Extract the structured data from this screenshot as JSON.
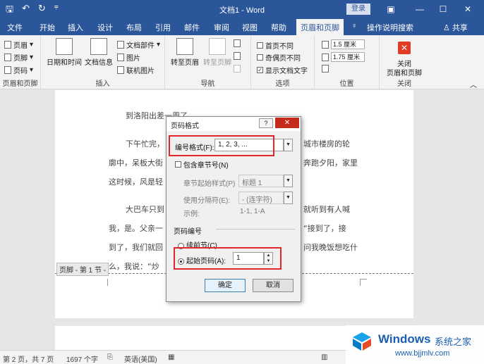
{
  "titlebar": {
    "title": "文档1 - Word",
    "login": "登录",
    "qat_save": "🖫",
    "qat_undo": "↶",
    "qat_redo": "↻",
    "qat_more": "⩦"
  },
  "tabs": [
    "文件",
    "开始",
    "插入",
    "设计",
    "布局",
    "引用",
    "邮件",
    "审阅",
    "视图",
    "帮助",
    "页眉和页脚",
    "操作说明搜索",
    "共享"
  ],
  "ribbon": {
    "hf_group": {
      "header": "页眉",
      "footer": "页脚",
      "page_number": "页码",
      "label": "页眉和页脚"
    },
    "insert_group": {
      "datetime": "日期和时间",
      "docinfo": "文档信息",
      "quickparts": "文档部件",
      "picture": "图片",
      "online_picture": "联机图片",
      "label": "插入"
    },
    "nav_group": {
      "goto_header": "转至页眉",
      "goto_footer": "转至页脚",
      "label": "导航"
    },
    "options_group": {
      "diff_first": "首页不同",
      "diff_odd_even": "奇偶页不同",
      "show_text": "显示文档文字",
      "label": "选项"
    },
    "position_group": {
      "header_pos": "1.5 厘米",
      "footer_pos": "1.75 厘米",
      "label": "位置"
    },
    "close_group": {
      "close": "关闭",
      "close2": "页眉和页脚",
      "label": "关闭"
    }
  },
  "document": {
    "line0": "到洛阳出差一周了。",
    "line1a": "下午忙完，",
    "line1b": "城市楼房的轮",
    "line2a": "廓中，呆板大街",
    "line2b": "奔跑夕阳，家里",
    "line3a": "这时候，风是轻",
    "line4a": "大巴车只到",
    "line4b": "就听到有人喊",
    "line5a": "我，是。父亲一",
    "line5b": "“接到了，接",
    "line6a": "到了，我们就回",
    "line6b": "问我晚饭想吃什",
    "line7a": "么，我说：“炒",
    "footer_label": "页脚 - 第 1 节 -"
  },
  "dialog": {
    "title": "页码格式",
    "help": "?",
    "close": "✕",
    "number_format_label": "编号格式(F):",
    "number_format_value": "1, 2, 3, ...",
    "include_chapter": "包含章节号(N)",
    "chapter_style_label": "章节起始样式(P)",
    "chapter_style_value": "标题 1",
    "separator_label": "使用分隔符(E):",
    "separator_value": "-  (连字符)",
    "example_label": "示例:",
    "example_value": "1-1, 1-A",
    "page_numbering": "页码编号",
    "continue_prev": "续前节(C)",
    "start_at_label": "起始页码(A):",
    "start_at_value": "1",
    "ok": "确定",
    "cancel": "取消"
  },
  "statusbar": {
    "page": "第 2 页，共 7 页",
    "words": "1697 个字",
    "lang": "英语(美国)"
  },
  "watermark": {
    "brand": "Windows",
    "cn": "系统之家",
    "url": "www.bjjmlv.com"
  },
  "colors": {
    "titlebar": "#2b579a",
    "highlight": "#e3262a",
    "close_button": "#e03b24"
  }
}
